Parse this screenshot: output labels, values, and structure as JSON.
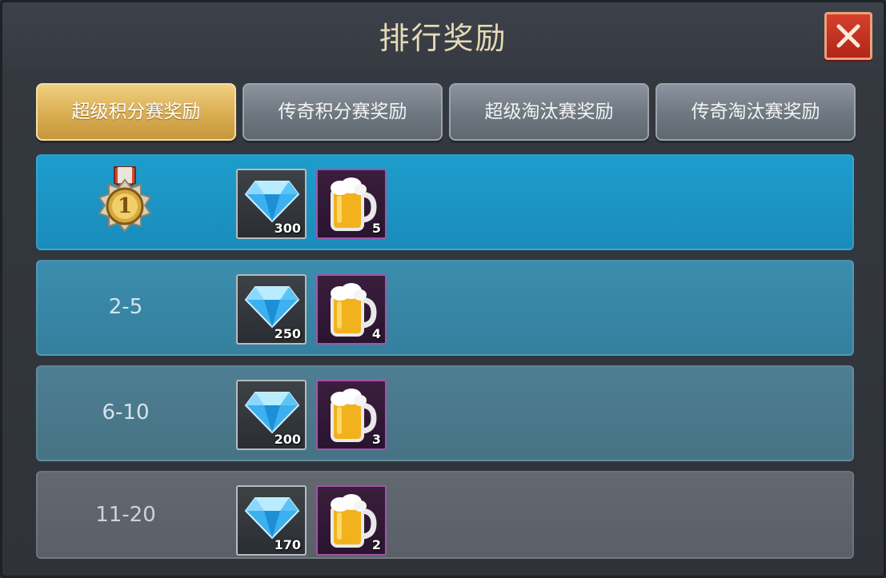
{
  "window": {
    "title": "排行奖励"
  },
  "colors": {
    "active_tab": "#d9ad52",
    "close_button": "#c7311f",
    "row_first": "#1d9dcc",
    "gem_frame": "#b6bcc2",
    "beer_frame": "#a254a8"
  },
  "tabs": [
    {
      "label": "超级积分赛奖励",
      "active": true
    },
    {
      "label": "传奇积分赛奖励",
      "active": false
    },
    {
      "label": "超级淘汰赛奖励",
      "active": false
    },
    {
      "label": "传奇淘汰赛奖励",
      "active": false
    }
  ],
  "rewards": [
    {
      "rank": "1",
      "rank_icon": "gold-medal-icon",
      "gems": "300",
      "beer": "5"
    },
    {
      "rank": "2-5",
      "gems": "250",
      "beer": "4"
    },
    {
      "rank": "6-10",
      "gems": "200",
      "beer": "3"
    },
    {
      "rank": "11-20",
      "gems": "170",
      "beer": "2"
    }
  ],
  "icons": {
    "close": "close-icon",
    "gem": "diamond-gem-icon",
    "beer": "beer-mug-icon"
  }
}
